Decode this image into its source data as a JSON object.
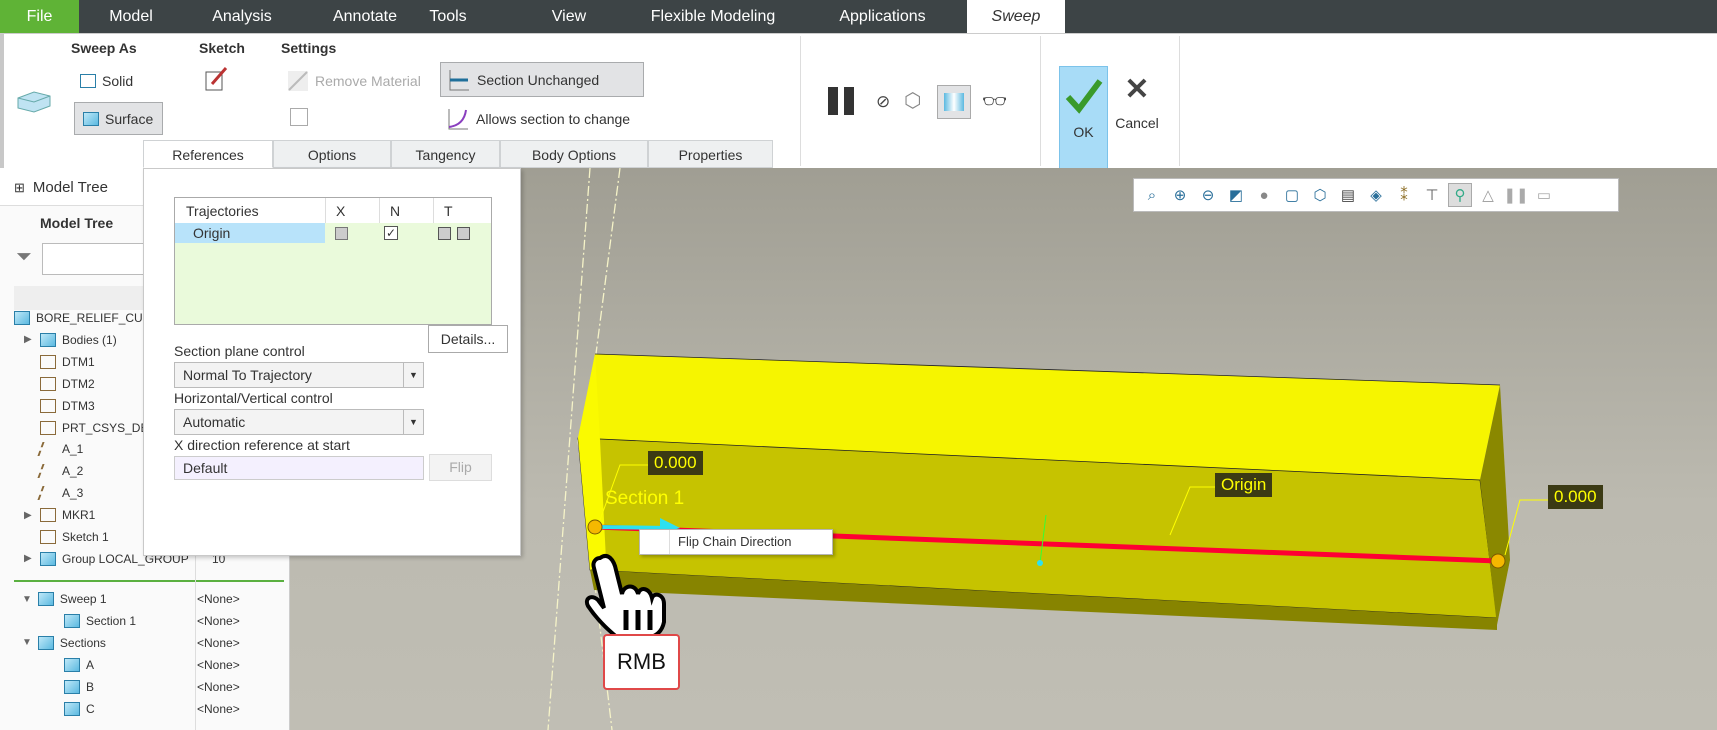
{
  "menu": {
    "tabs": [
      "File",
      "Model",
      "Analysis",
      "Annotate",
      "Tools",
      "View",
      "Flexible Modeling",
      "Applications",
      "Sweep"
    ],
    "active": "Sweep",
    "file_color": "#5fb336"
  },
  "ribbon": {
    "sweep_as": {
      "label": "Sweep As",
      "solid": "Solid",
      "surface": "Surface",
      "selected": "Surface"
    },
    "sketch": {
      "label": "Sketch"
    },
    "settings": {
      "label": "Settings",
      "remove_material": "Remove Material",
      "section_unchanged": "Section Unchanged",
      "allows_change": "Allows section to change",
      "selected": "Section Unchanged"
    },
    "ok": "OK",
    "cancel": "Cancel"
  },
  "dashboard_tabs": [
    "References",
    "Options",
    "Tangency",
    "Body Options",
    "Properties"
  ],
  "references": {
    "table": {
      "headers": [
        "Trajectories",
        "X",
        "N",
        "T"
      ],
      "rows": [
        {
          "name": "Origin",
          "x": false,
          "n": true,
          "t": [
            false,
            false
          ]
        }
      ]
    },
    "details": "Details...",
    "section_plane_label": "Section plane control",
    "section_plane_value": "Normal To Trajectory",
    "hv_label": "Horizontal/Vertical control",
    "hv_value": "Automatic",
    "xdir_label": "X direction reference at start",
    "xdir_value": "Default",
    "flip": "Flip"
  },
  "tree": {
    "tab": "Model Tree",
    "header": "Model Tree",
    "filter_placeholder": "",
    "items": [
      {
        "label": "BORE_RELIEF_CUT",
        "value": ""
      },
      {
        "label": "Bodies (1)",
        "value": ""
      },
      {
        "label": "DTM1",
        "value": ""
      },
      {
        "label": "DTM2",
        "value": ""
      },
      {
        "label": "DTM3",
        "value": ""
      },
      {
        "label": "PRT_CSYS_DEF",
        "value": ""
      },
      {
        "label": "A_1",
        "value": ""
      },
      {
        "label": "A_2",
        "value": ""
      },
      {
        "label": "A_3",
        "value": ""
      },
      {
        "label": "MKR1",
        "value": ""
      },
      {
        "label": "Sketch 1",
        "value": ""
      },
      {
        "label": "Group LOCAL_GROUP",
        "value": "10"
      }
    ],
    "feature_items": [
      {
        "label": "Sweep 1",
        "value": "<None>"
      },
      {
        "label": "Section 1",
        "value": "<None>"
      },
      {
        "label": "Sections",
        "value": "<None>"
      },
      {
        "label": "A",
        "value": "<None>"
      },
      {
        "label": "B",
        "value": "<None>"
      },
      {
        "label": "C",
        "value": "<None>"
      }
    ]
  },
  "viewport": {
    "dim_left": "0.000",
    "dim_right": "0.000",
    "section_label": "Section 1",
    "origin_label": "Origin",
    "context_menu": "Flip Chain Direction",
    "mouse_hint": "RMB"
  }
}
